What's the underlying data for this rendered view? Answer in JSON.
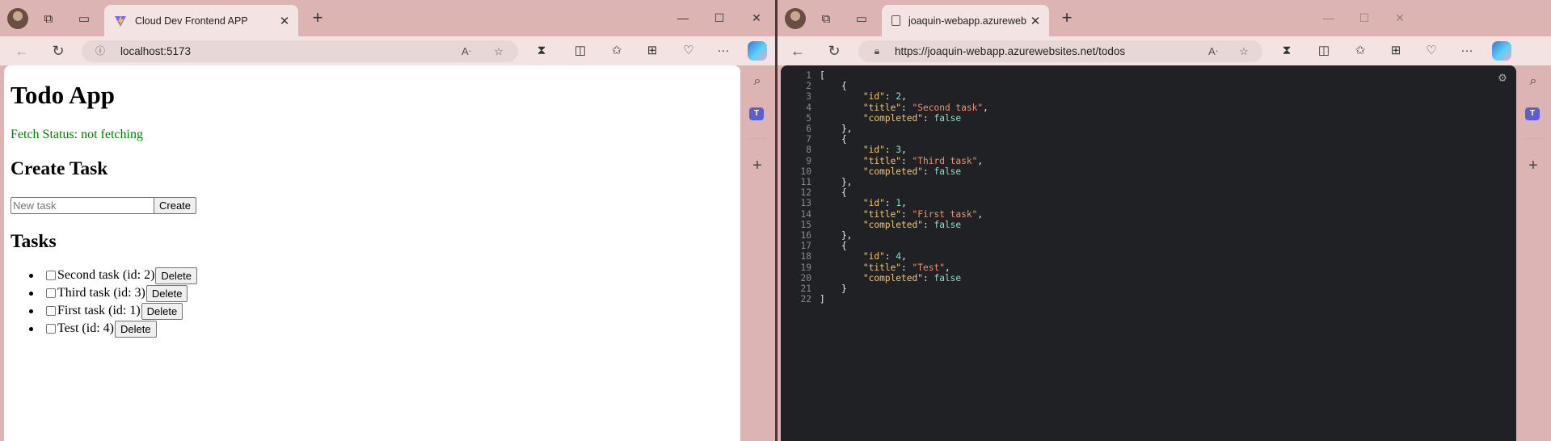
{
  "left_window": {
    "tab_title": "Cloud Dev Frontend APP",
    "url": "localhost:5173",
    "page": {
      "heading": "Todo App",
      "fetch_status": "Fetch Status: not fetching",
      "create_heading": "Create Task",
      "new_task_placeholder": "New task",
      "create_button": "Create",
      "tasks_heading": "Tasks",
      "tasks": [
        {
          "label": "Second task (id: 2)",
          "delete": "Delete",
          "checked": false
        },
        {
          "label": "Third task (id: 3)",
          "delete": "Delete",
          "checked": false
        },
        {
          "label": "First task (id: 1)",
          "delete": "Delete",
          "checked": false
        },
        {
          "label": "Test (id: 4)",
          "delete": "Delete",
          "checked": false
        }
      ]
    }
  },
  "right_window": {
    "tab_title": "joaquin-webapp.azurewebsites.net",
    "url": "https://joaquin-webapp.azurewebsites.net/todos",
    "json_lines": [
      {
        "n": "1",
        "parts": [
          [
            "p",
            "["
          ]
        ]
      },
      {
        "n": "2",
        "parts": [
          [
            "p",
            "    {"
          ]
        ]
      },
      {
        "n": "3",
        "parts": [
          [
            "p",
            "        "
          ],
          [
            "k",
            "\"id\""
          ],
          [
            "p",
            ": "
          ],
          [
            "n",
            "2"
          ],
          [
            "p",
            ","
          ]
        ]
      },
      {
        "n": "4",
        "parts": [
          [
            "p",
            "        "
          ],
          [
            "k",
            "\"title\""
          ],
          [
            "p",
            ": "
          ],
          [
            "s",
            "\"Second task\""
          ],
          [
            "p",
            ","
          ]
        ]
      },
      {
        "n": "5",
        "parts": [
          [
            "p",
            "        "
          ],
          [
            "k",
            "\"completed\""
          ],
          [
            "p",
            ": "
          ],
          [
            "b",
            "false"
          ]
        ]
      },
      {
        "n": "6",
        "parts": [
          [
            "p",
            "    },"
          ]
        ]
      },
      {
        "n": "7",
        "parts": [
          [
            "p",
            "    {"
          ]
        ]
      },
      {
        "n": "8",
        "parts": [
          [
            "p",
            "        "
          ],
          [
            "k",
            "\"id\""
          ],
          [
            "p",
            ": "
          ],
          [
            "n",
            "3"
          ],
          [
            "p",
            ","
          ]
        ]
      },
      {
        "n": "9",
        "parts": [
          [
            "p",
            "        "
          ],
          [
            "k",
            "\"title\""
          ],
          [
            "p",
            ": "
          ],
          [
            "s",
            "\"Third task\""
          ],
          [
            "p",
            ","
          ]
        ]
      },
      {
        "n": "10",
        "parts": [
          [
            "p",
            "        "
          ],
          [
            "k",
            "\"completed\""
          ],
          [
            "p",
            ": "
          ],
          [
            "b",
            "false"
          ]
        ]
      },
      {
        "n": "11",
        "parts": [
          [
            "p",
            "    },"
          ]
        ]
      },
      {
        "n": "12",
        "parts": [
          [
            "p",
            "    {"
          ]
        ]
      },
      {
        "n": "13",
        "parts": [
          [
            "p",
            "        "
          ],
          [
            "k",
            "\"id\""
          ],
          [
            "p",
            ": "
          ],
          [
            "n",
            "1"
          ],
          [
            "p",
            ","
          ]
        ]
      },
      {
        "n": "14",
        "parts": [
          [
            "p",
            "        "
          ],
          [
            "k",
            "\"title\""
          ],
          [
            "p",
            ": "
          ],
          [
            "s",
            "\"First task\""
          ],
          [
            "p",
            ","
          ]
        ]
      },
      {
        "n": "15",
        "parts": [
          [
            "p",
            "        "
          ],
          [
            "k",
            "\"completed\""
          ],
          [
            "p",
            ": "
          ],
          [
            "b",
            "false"
          ]
        ]
      },
      {
        "n": "16",
        "parts": [
          [
            "p",
            "    },"
          ]
        ]
      },
      {
        "n": "17",
        "parts": [
          [
            "p",
            "    {"
          ]
        ]
      },
      {
        "n": "18",
        "parts": [
          [
            "p",
            "        "
          ],
          [
            "k",
            "\"id\""
          ],
          [
            "p",
            ": "
          ],
          [
            "n",
            "4"
          ],
          [
            "p",
            ","
          ]
        ]
      },
      {
        "n": "19",
        "parts": [
          [
            "p",
            "        "
          ],
          [
            "k",
            "\"title\""
          ],
          [
            "p",
            ": "
          ],
          [
            "s",
            "\"Test\""
          ],
          [
            "p",
            ","
          ]
        ]
      },
      {
        "n": "20",
        "parts": [
          [
            "p",
            "        "
          ],
          [
            "k",
            "\"completed\""
          ],
          [
            "p",
            ": "
          ],
          [
            "b",
            "false"
          ]
        ]
      },
      {
        "n": "21",
        "parts": [
          [
            "p",
            "    }"
          ]
        ]
      },
      {
        "n": "22",
        "parts": [
          [
            "p",
            "]"
          ]
        ]
      }
    ]
  },
  "icons": {
    "window_controls": [
      "minimize-icon",
      "maximize-icon",
      "close-icon"
    ],
    "toolbar": [
      "read-aloud-icon",
      "favorite-star-icon",
      "extensions-icon",
      "split-screen-icon",
      "favorites-icon",
      "collections-icon",
      "browser-essentials-icon",
      "more-icon",
      "copilot-icon"
    ],
    "sidebar": [
      "search-icon",
      "teams-icon",
      "add-icon"
    ]
  },
  "colors": {
    "titlebar": "#dcb4b4",
    "toolbar": "#f4e3e3",
    "fetch_status": "#008000",
    "json_background": "#202124",
    "json_key": "#f1c872",
    "json_string": "#f09070",
    "json_value": "#8ee0c4"
  }
}
